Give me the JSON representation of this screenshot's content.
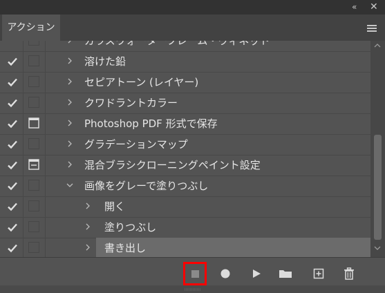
{
  "titlebar": {
    "collapse_glyph": "«",
    "close_glyph": "✕"
  },
  "tab": {
    "label": "アクション",
    "menu_icon": "panel-menu-icon"
  },
  "rows": [
    {
      "label": "ガラスウォーターフレーム・ヴィネット",
      "checked": false,
      "dialog": "empty",
      "indent": 0,
      "expanded": false,
      "partial": true
    },
    {
      "label": "溶けた鉛",
      "checked": true,
      "dialog": "empty",
      "indent": 0,
      "expanded": false
    },
    {
      "label": "セピアトーン (レイヤー)",
      "checked": true,
      "dialog": "empty",
      "indent": 0,
      "expanded": false
    },
    {
      "label": "クワドラントカラー",
      "checked": true,
      "dialog": "empty",
      "indent": 0,
      "expanded": false
    },
    {
      "label": "Photoshop PDF 形式で保存",
      "checked": true,
      "dialog": "window",
      "indent": 0,
      "expanded": false
    },
    {
      "label": "グラデーションマップ",
      "checked": true,
      "dialog": "empty",
      "indent": 0,
      "expanded": false
    },
    {
      "label": "混合ブラシクローニングペイント設定",
      "checked": true,
      "dialog": "partial",
      "indent": 0,
      "expanded": false
    },
    {
      "label": "画像をグレーで塗りつぶし",
      "checked": true,
      "dialog": "empty",
      "indent": 0,
      "expanded": true
    },
    {
      "label": "開く",
      "checked": true,
      "dialog": "empty",
      "indent": 1,
      "expanded": false
    },
    {
      "label": "塗りつぶし",
      "checked": true,
      "dialog": "empty",
      "indent": 1,
      "expanded": false
    },
    {
      "label": "書き出し",
      "checked": true,
      "dialog": "empty",
      "indent": 1,
      "expanded": false,
      "selected": true
    }
  ],
  "toolbar": {
    "buttons": [
      {
        "name": "stop-playing-recording-button",
        "icon": "stop-icon",
        "highlighted": true
      },
      {
        "name": "begin-recording-button",
        "icon": "record-icon"
      },
      {
        "name": "play-selection-button",
        "icon": "play-icon"
      },
      {
        "name": "create-new-set-button",
        "icon": "folder-icon"
      },
      {
        "name": "create-new-action-button",
        "icon": "new-item-icon"
      },
      {
        "name": "delete-button",
        "icon": "trash-icon"
      }
    ]
  },
  "colors": {
    "panel_bg": "#535353",
    "text": "#e6e6e6",
    "highlight_border": "#ff0000",
    "selected_row": "#6b6b6b"
  }
}
